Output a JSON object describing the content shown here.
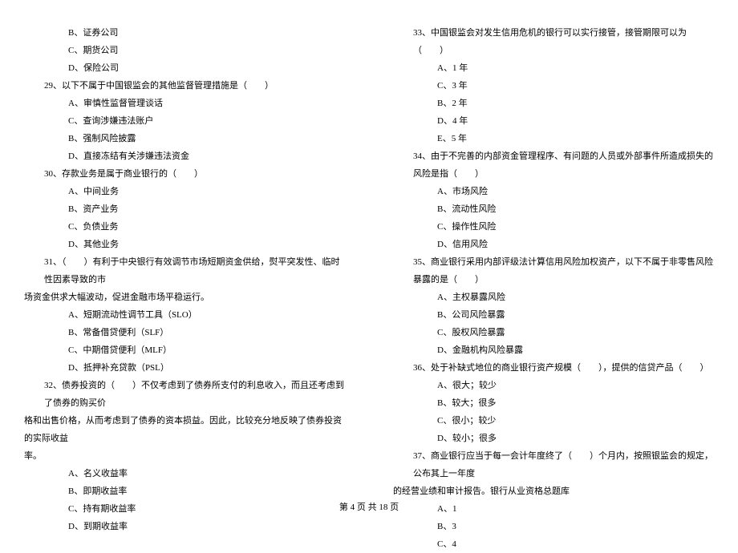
{
  "left_col": {
    "opts_top": [
      "B、证券公司",
      "C、期货公司",
      "D、保险公司"
    ],
    "q29": "29、以下不属于中国银监会的其他监督管理措施是（　　）",
    "q29_opts": [
      "A、审慎性监督管理谈话",
      "C、查询涉嫌违法账户",
      "B、强制风险披露",
      "D、直接冻结有关涉嫌违法资金"
    ],
    "q30": "30、存款业务是属于商业银行的（　　）",
    "q30_opts": [
      "A、中间业务",
      "B、资产业务",
      "C、负债业务",
      "D、其他业务"
    ],
    "q31": "31、（　　）有利于中央银行有效调节市场短期资金供给，熨平突发性、临时性因素导致的市",
    "q31_cont": "场资金供求大幅波动，促进金融市场平稳运行。",
    "q31_opts": [
      "A、短期流动性调节工具（SLO）",
      "B、常备借贷便利（SLF）",
      "C、中期借贷便利（MLF）",
      "D、抵押补充贷款（PSL）"
    ],
    "q32": "32、债券投资的（　　）不仅考虑到了债券所支付的利息收入，而且还考虑到了债券的购买价",
    "q32_cont": "格和出售价格，从而考虑到了债券的资本损益。因此，比较充分地反映了债券投资的实际收益",
    "q32_cont2": "率。",
    "q32_opts": [
      "A、名义收益率",
      "B、即期收益率",
      "C、持有期收益率",
      "D、到期收益率"
    ]
  },
  "right_col": {
    "q33": "33、中国银监会对发生信用危机的银行可以实行接管，接管期限可以为（　　）",
    "q33_opts": [
      "A、1 年",
      "C、3 年",
      "B、2 年",
      "D、4 年",
      "E、5 年"
    ],
    "q34": "34、由于不完善的内部资金管理程序、有问题的人员或外部事件所造成损失的风险是指（　　）",
    "q34_opts": [
      "A、市场风险",
      "B、流动性风险",
      "C、操作性风险",
      "D、信用风险"
    ],
    "q35": "35、商业银行采用内部评级法计算信用风险加权资产，以下不属于非零售风险暴露的是（　　）",
    "q35_opts": [
      "A、主权暴露风险",
      "B、公司风险暴露",
      "C、股权风险暴露",
      "D、金融机构风险暴露"
    ],
    "q36": "36、处于补缺式地位的商业银行资产规模（　　），提供的信贷产品（　　）",
    "q36_opts": [
      "A、很大；较少",
      "B、较大；很多",
      "C、很小；较少",
      "D、较小；很多"
    ],
    "q37": "37、商业银行应当于每一会计年度终了（　　）个月内，按照银监会的规定，公布其上一年度",
    "q37_cont": "的经营业绩和审计报告。银行从业资格总题库",
    "q37_opts": [
      "A、1",
      "B、3",
      "C、4"
    ]
  },
  "footer": "第 4 页 共 18 页"
}
